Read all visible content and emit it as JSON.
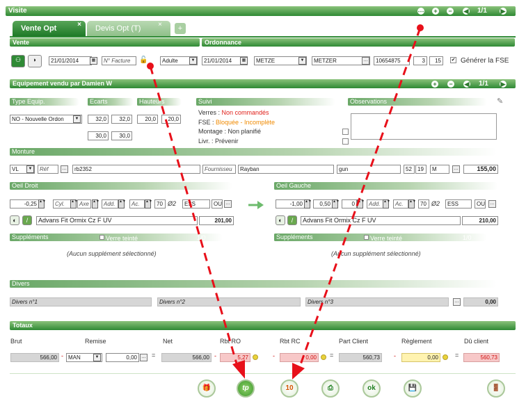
{
  "window_title": "Visite",
  "header_nav": {
    "counter": "1/1"
  },
  "tabs": [
    {
      "label": "Vente Opt",
      "close": "×"
    },
    {
      "label": "Devis Opt (T)",
      "close": "×"
    }
  ],
  "add_tab": "+",
  "vente": {
    "title": "Vente",
    "date": "21/01/2014",
    "invoice_placeholder": "N° Facture",
    "client_type": "Adulte"
  },
  "ordonnance": {
    "title": "Ordonnance",
    "date": "21/01/2014",
    "doctor_select": "METZE",
    "doctor_field": "METZER",
    "number": "10654875",
    "v1": "3",
    "v2": "15",
    "generate_fse": "Générer la FSE"
  },
  "equipement": {
    "title": "Equipement  vendu par Damien W",
    "counter": "1/1"
  },
  "type_equip": {
    "title": "Type Equip.",
    "value": "NO - Nouvelle Ordon"
  },
  "ecarts": {
    "title": "Ecarts",
    "r1a": "32,0",
    "r1b": "32,0",
    "r2a": "30,0",
    "r2b": "30,0"
  },
  "hauteurs": {
    "title": "Hauteurs",
    "a": "20,0",
    "b": "20,0"
  },
  "suivi": {
    "title": "Suivi",
    "verres_label": "Verres : ",
    "verres_value": "Non commandés",
    "fse_label": "FSE : ",
    "fse_value": "Bloquée - Incomplète",
    "montage": "Montage : Non planifié",
    "livr": "Livr. : Prévenir"
  },
  "observations": {
    "title": "Observations"
  },
  "monture": {
    "title": "Monture",
    "type": "VL",
    "ref_ph": "Réf",
    "ref": "rb2352",
    "fournisseur_ph": "Fournisseu",
    "fournisseur": "Rayban",
    "color": "gun",
    "size1": "52",
    "size2": "19",
    "size3": "M",
    "price": "155,00"
  },
  "oeil_droit": {
    "title": "Oeil Droit",
    "sph": "-0,25",
    "cyl_ph": "Cyl.",
    "axe_ph": "Axe",
    "add_ph": "Add.",
    "ac_ph": "Ac.",
    "diam": "70",
    "diam_label": "Ø2",
    "ess": "ESS",
    "ou": "OU",
    "lens": "Advans Fit Ormix Cz F UV",
    "price": "201,00"
  },
  "oeil_gauche": {
    "title": "Oeil Gauche",
    "sph": "-1,00",
    "cyl": "0,50",
    "axe": "0",
    "add_ph": "Add.",
    "ac_ph": "Ac.",
    "diam": "70",
    "diam_label": "Ø2",
    "ess": "ESS",
    "ou": "OU",
    "lens": "Advans Fit Ormix Cz F UV",
    "price": "210,00"
  },
  "supplements": {
    "title": "Suppléments",
    "verre_teinte": "Verre teinté",
    "pager": "1/0",
    "none": "(Aucun supplément sélectionné)"
  },
  "divers": {
    "title": "Divers",
    "f1": "Divers n°1",
    "f2": "Divers n°2",
    "f3": "Divers n°3",
    "total": "0,00"
  },
  "totaux": {
    "title": "Totaux",
    "headers": {
      "brut": "Brut",
      "remise": "Remise",
      "net": "Net",
      "rbt_ro": "Rbt RO",
      "rbt_rc": "Rbt RC",
      "part_client": "Part Client",
      "reglement": "Règlement",
      "du_client": "Dû client"
    },
    "brut": "566,00",
    "remise_type": "MAN",
    "remise": "0,00",
    "net": "566,00",
    "rbt_ro": "5,27",
    "rbt_rc": "0,00",
    "part_client": "560,73",
    "reglement": "0,00",
    "du_client": "560,73",
    "minus": "-",
    "eq": "="
  },
  "toolbar": {
    "tp": "tp",
    "cal": "10",
    "ok": "ok"
  },
  "colors": {
    "accent_green": "#2f8a35",
    "annotation_red": "#e8101a"
  }
}
